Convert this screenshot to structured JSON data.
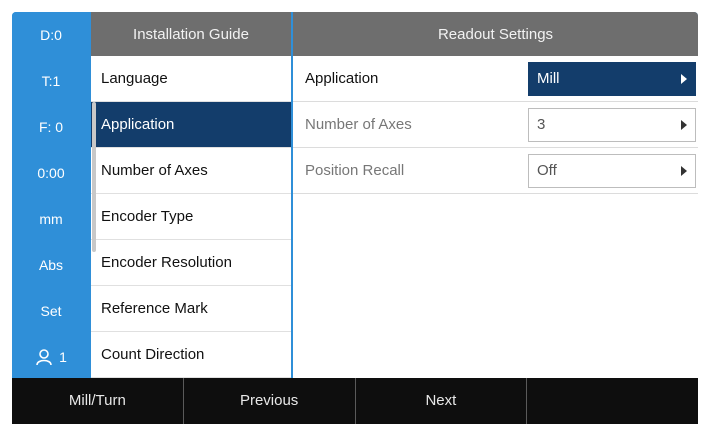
{
  "status": [
    {
      "label": "D:0"
    },
    {
      "label": "T:1"
    },
    {
      "label": "F:  0"
    },
    {
      "label": "0:00"
    },
    {
      "label": "mm"
    },
    {
      "label": "Abs"
    },
    {
      "label": "Set"
    },
    {
      "label": "1",
      "icon": "user-icon"
    }
  ],
  "header": {
    "left_title": "Installation Guide",
    "right_title": "Readout Settings"
  },
  "menu": {
    "items": [
      {
        "label": "Language"
      },
      {
        "label": "Application",
        "active": true
      },
      {
        "label": "Number of Axes"
      },
      {
        "label": "Encoder Type"
      },
      {
        "label": "Encoder Resolution"
      },
      {
        "label": "Reference Mark"
      },
      {
        "label": "Count Direction"
      }
    ]
  },
  "settings": [
    {
      "label": "Application",
      "value": "Mill",
      "current": true
    },
    {
      "label": "Number of Axes",
      "value": "3"
    },
    {
      "label": "Position Recall",
      "value": "Off"
    }
  ],
  "softkeys": [
    {
      "label": "Mill/Turn"
    },
    {
      "label": "Previous"
    },
    {
      "label": "Next"
    },
    {
      "label": ""
    }
  ],
  "colors": {
    "status_bg": "#2f8fd8",
    "header_bg": "#6e6e6e",
    "selected_bg": "#133d6b",
    "softkey_bg": "#0e0e0e"
  }
}
